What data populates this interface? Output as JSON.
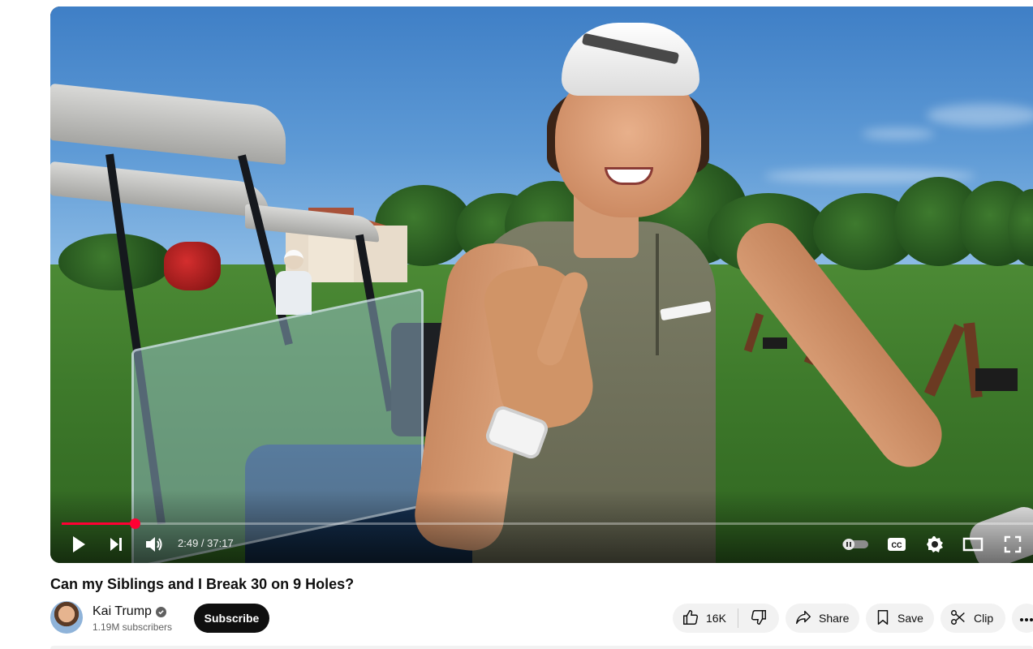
{
  "player": {
    "current_time": "2:49",
    "duration": "37:17",
    "time_display": "2:49 / 37:17",
    "progress_fraction": 0.0756,
    "accent_color": "#ff0033",
    "icons": [
      "play-icon",
      "next-icon",
      "volume-icon",
      "autoplay-toggle-icon",
      "captions-icon",
      "settings-icon",
      "theater-mode-icon",
      "fullscreen-icon"
    ]
  },
  "video": {
    "title": "Can my Siblings and I Break 30 on 9 Holes?"
  },
  "channel": {
    "name": "Kai Trump",
    "subscribers": "1.19M subscribers",
    "verified": true
  },
  "actions": {
    "subscribe_label": "Subscribe",
    "like_count": "16K",
    "share_label": "Share",
    "save_label": "Save",
    "clip_label": "Clip"
  },
  "colors": {
    "subscribe_bg": "#0f0f0f",
    "pill_bg": "#f2f2f2",
    "text_primary": "#0f0f0f",
    "text_secondary": "#606060"
  }
}
